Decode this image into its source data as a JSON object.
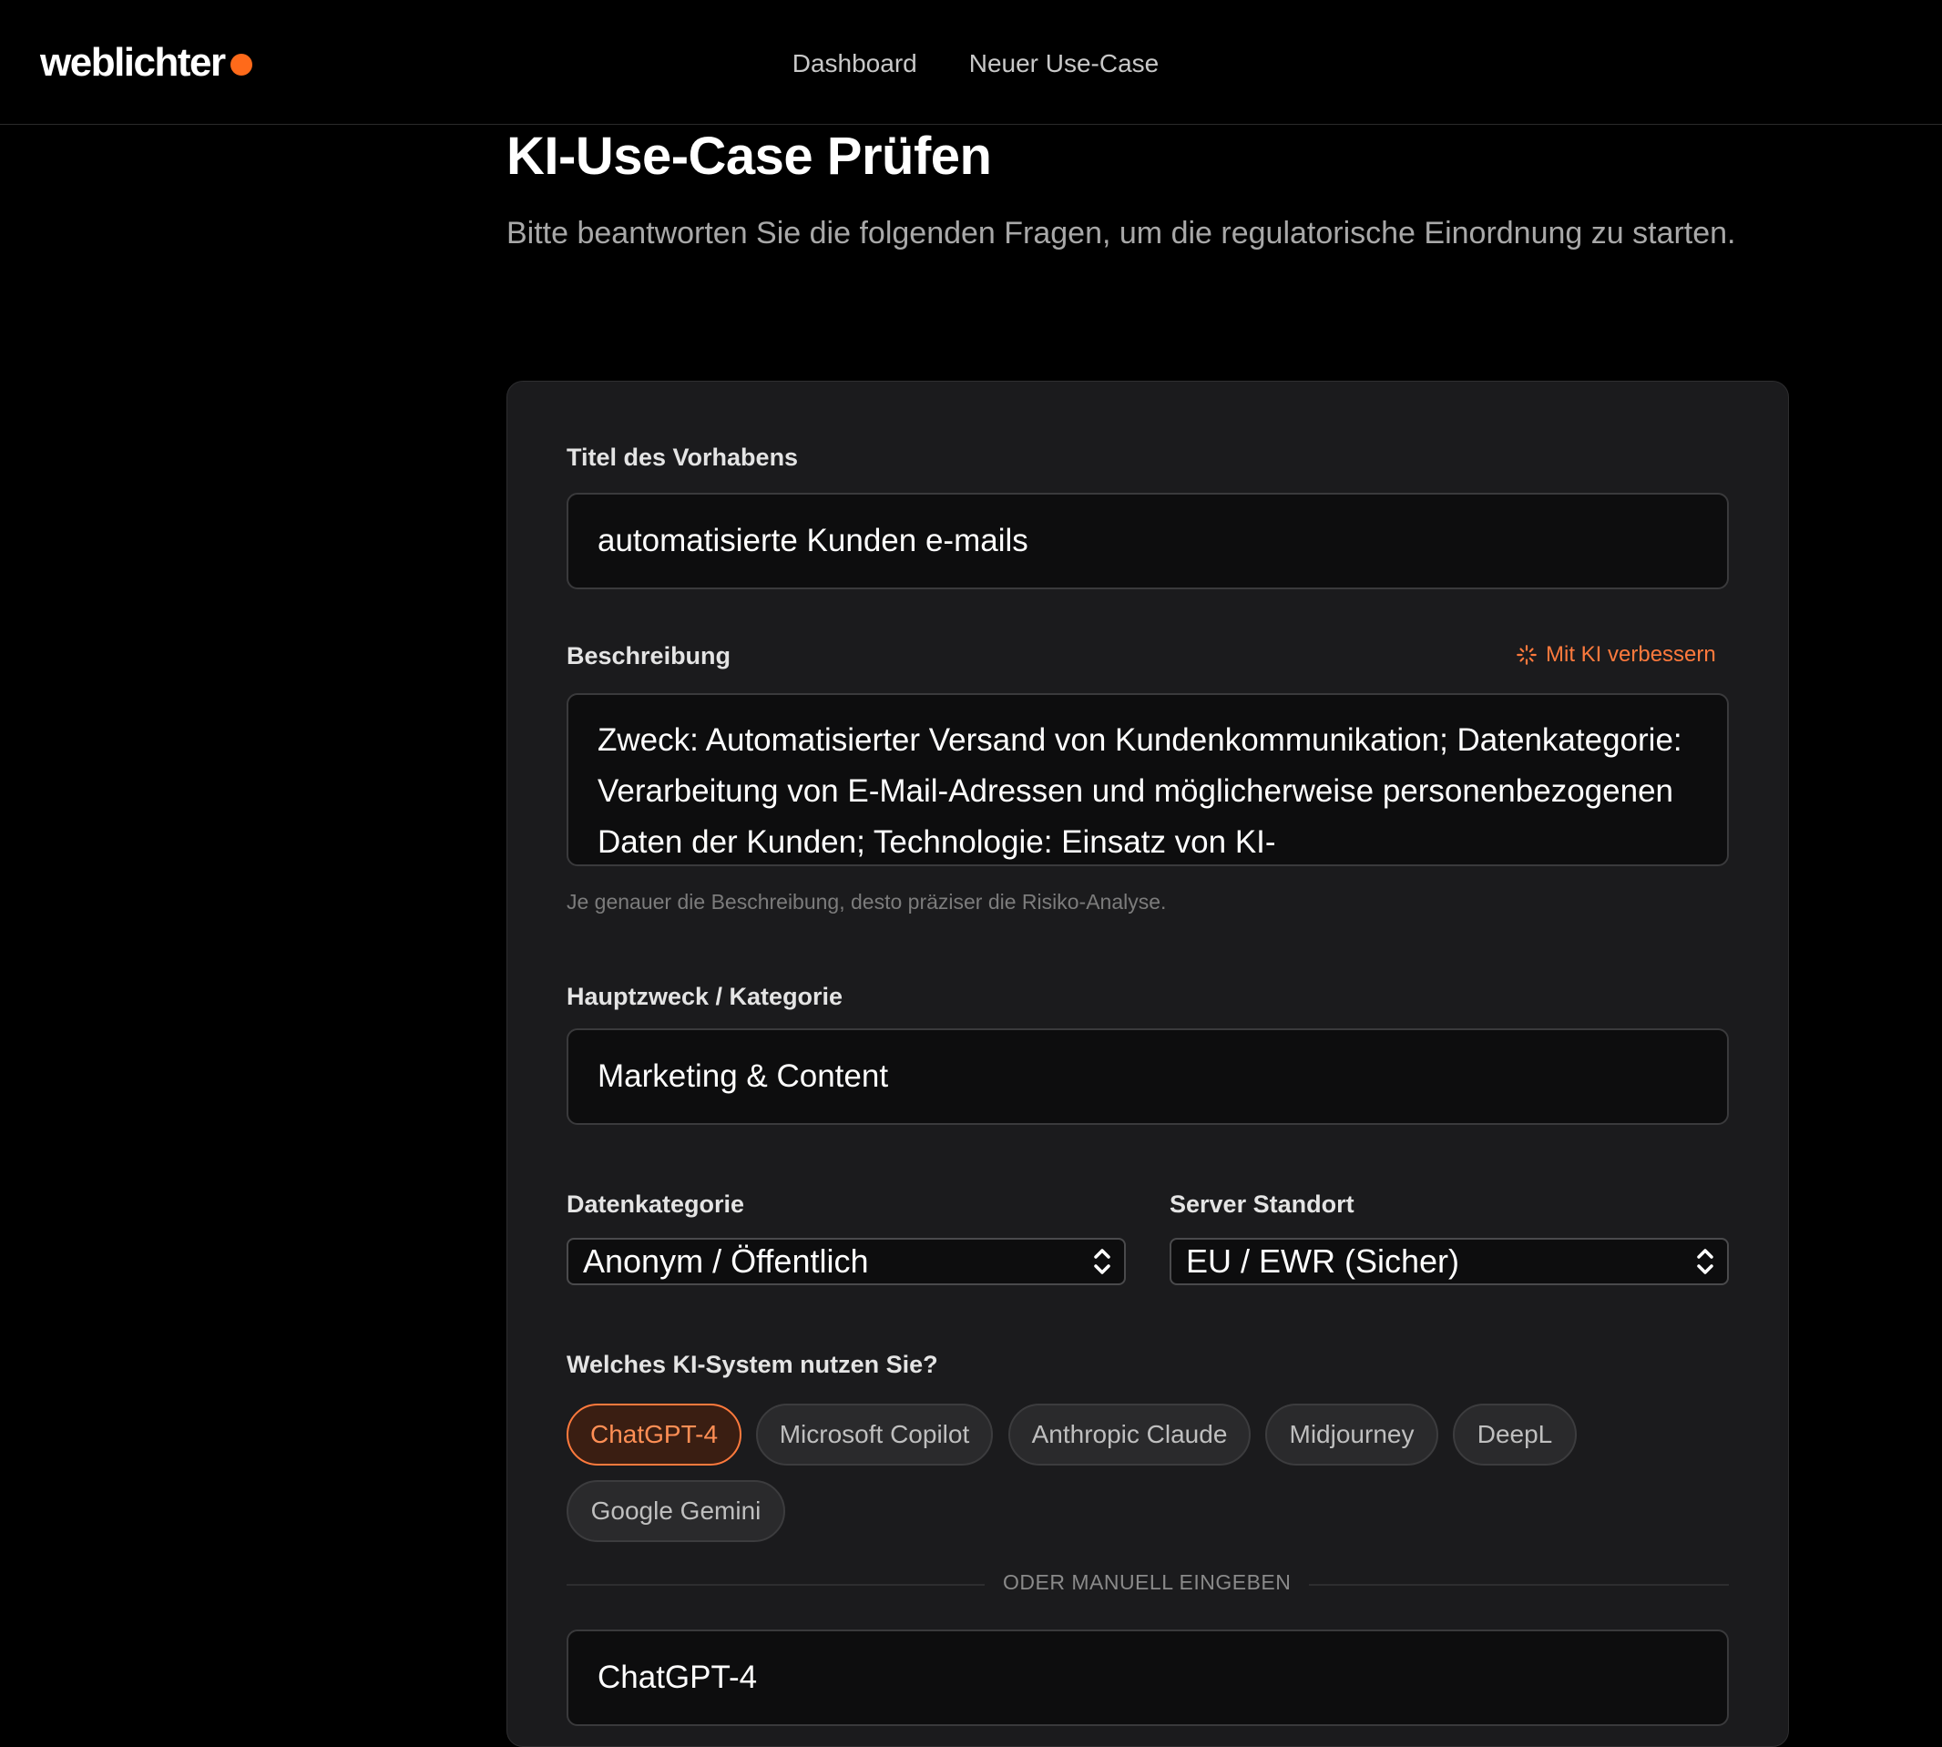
{
  "brand": {
    "name": "weblichter",
    "accent": "#ff6a1a"
  },
  "nav": {
    "items": [
      "Dashboard",
      "Neuer Use-Case"
    ]
  },
  "page": {
    "title": "KI-Use-Case Prüfen",
    "subtitle": "Bitte beantworten Sie die folgenden Fragen, um die regulatorische Einordnung zu starten."
  },
  "form": {
    "title_label": "Titel des Vorhabens",
    "title_value": "automatisierte Kunden e-mails",
    "description_label": "Beschreibung",
    "ai_improve_label": "Mit KI verbessern",
    "ai_improve_icon": "sparkle-icon",
    "description_value": "Zweck: Automatisierter Versand von Kundenkommunikation; Datenkategorie: Verarbeitung von E-Mail-Adressen und möglicherweise personenbezogenen Daten der Kunden; Technologie: Einsatz von KI-",
    "description_hint": "Je genauer die Beschreibung, desto präziser die Risiko-Analyse.",
    "category_label": "Hauptzweck / Kategorie",
    "category_value": "Marketing & Content",
    "data_category_label": "Datenkategorie",
    "data_category_value": "Anonym / Öffentlich",
    "server_label": "Server Standort",
    "server_value": "EU / EWR (Sicher)",
    "ai_system_label": "Welches KI-System nutzen Sie?",
    "ai_systems": [
      "ChatGPT-4",
      "Microsoft Copilot",
      "Anthropic Claude",
      "Midjourney",
      "DeepL",
      "Google Gemini"
    ],
    "ai_system_selected": "ChatGPT-4",
    "manual_divider": "ODER MANUELL EINGEBEN",
    "manual_value": "ChatGPT-4"
  },
  "colors": {
    "accent": "#ff7a3d",
    "background": "#000000",
    "card": "#1b1b1d"
  }
}
